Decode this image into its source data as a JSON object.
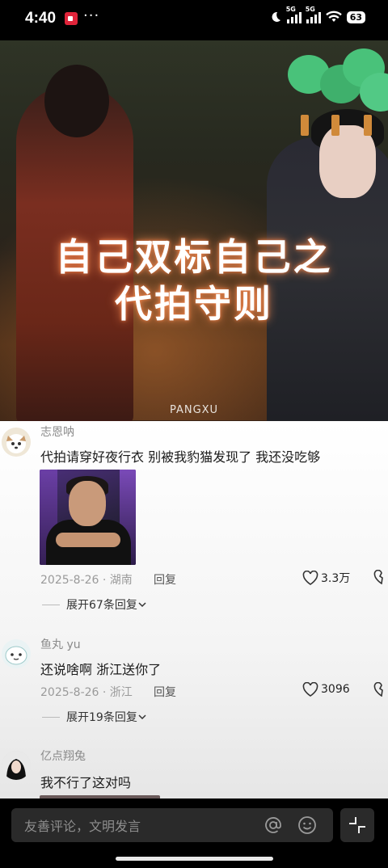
{
  "status_bar": {
    "time": "4:40",
    "dots": "···",
    "signal1": "5G",
    "signal2": "5G",
    "battery": "63"
  },
  "video": {
    "caption_line1": "自己双标自己之",
    "caption_line2": "代拍守则",
    "watermark": "PANGXU"
  },
  "comments": [
    {
      "username": "志恩呐",
      "text": "代拍请穿好夜行衣 别被我豹猫发现了 我还没吃够",
      "date_location": "2025-8-26 · 湖南",
      "reply_label": "回复",
      "likes": "3.3万",
      "expand_label": "展开67条回复"
    },
    {
      "username": "鱼丸 yu",
      "text": "还说啥啊 浙江送你了",
      "date_location": "2025-8-26 · 浙江",
      "reply_label": "回复",
      "likes": "3096",
      "expand_label": "展开19条回复"
    },
    {
      "username": "亿点翔兔",
      "text": "我不行了这对吗"
    }
  ],
  "bottom_bar": {
    "placeholder": "友善评论，文明发言"
  },
  "icons": {
    "at": "at-icon",
    "emoji": "emoji-icon",
    "collapse": "collapse-icon",
    "like": "heart-icon",
    "dislike": "broken-heart-icon",
    "chevron": "chevron-down-icon",
    "record": "screen-record-icon",
    "wifi": "wifi-icon",
    "moon": "moon-icon"
  }
}
